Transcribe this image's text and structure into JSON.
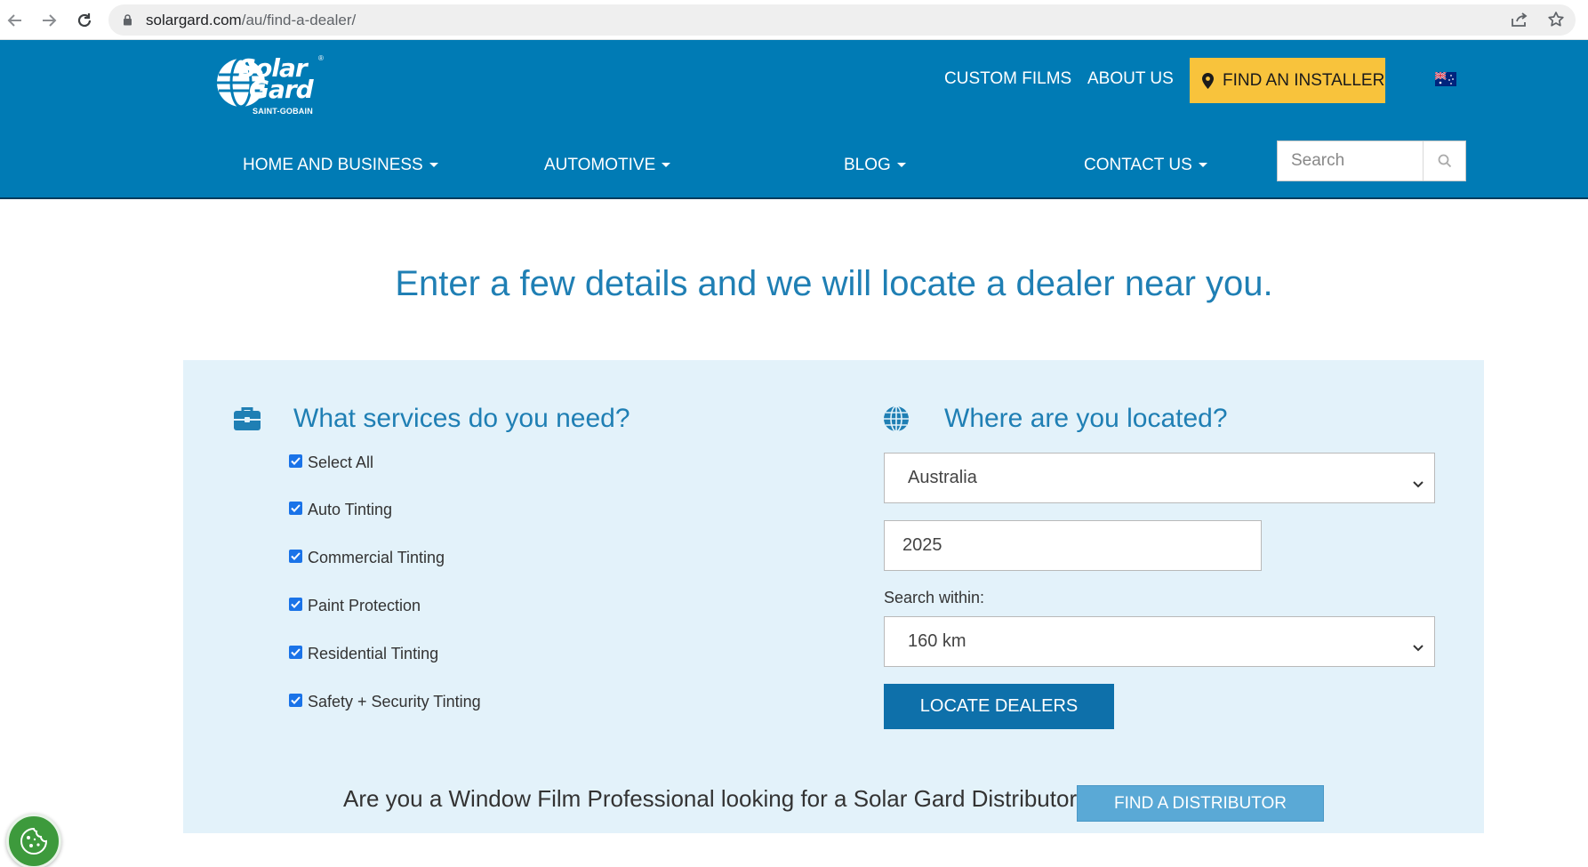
{
  "browser": {
    "url_domain": "solargard.com",
    "url_path": "/au/find-a-dealer/"
  },
  "header": {
    "logo_text_1": "Solar",
    "logo_text_2": "Gard",
    "logo_sub": "SAINT-GOBAIN",
    "logo_reg": "®",
    "top_links": {
      "custom_films": "CUSTOM FILMS",
      "about_us": "ABOUT US",
      "find_installer": "FIND AN INSTALLER"
    },
    "nav": {
      "home_business": "HOME AND BUSINESS",
      "automotive": "AUTOMOTIVE",
      "blog": "BLOG",
      "contact_us": "CONTACT US"
    },
    "search_placeholder": "Search",
    "colors": {
      "brand_blue": "#007bb5",
      "installer_yellow": "#f8c33c"
    }
  },
  "main": {
    "heading": "Enter a few details and we will locate a dealer near you."
  },
  "services": {
    "title": "What services do you need?",
    "icon": "briefcase-icon",
    "options": [
      {
        "label": "Select All",
        "checked": true
      },
      {
        "label": "Auto Tinting",
        "checked": true
      },
      {
        "label": "Commercial Tinting",
        "checked": true
      },
      {
        "label": "Paint Protection",
        "checked": true
      },
      {
        "label": "Residential Tinting",
        "checked": true
      },
      {
        "label": "Safety + Security Tinting",
        "checked": true
      }
    ]
  },
  "location": {
    "title": "Where are you located?",
    "icon": "globe-icon",
    "country": "Australia",
    "postcode": "2025",
    "within_label": "Search within:",
    "radius": "160 km",
    "locate_button": "LOCATE DEALERS"
  },
  "distributor": {
    "text": "Are you a Window Film Professional looking for a Solar Gard Distributor?",
    "button": "FIND A DISTRIBUTOR"
  },
  "cookie": {
    "icon": "cookie-icon"
  }
}
